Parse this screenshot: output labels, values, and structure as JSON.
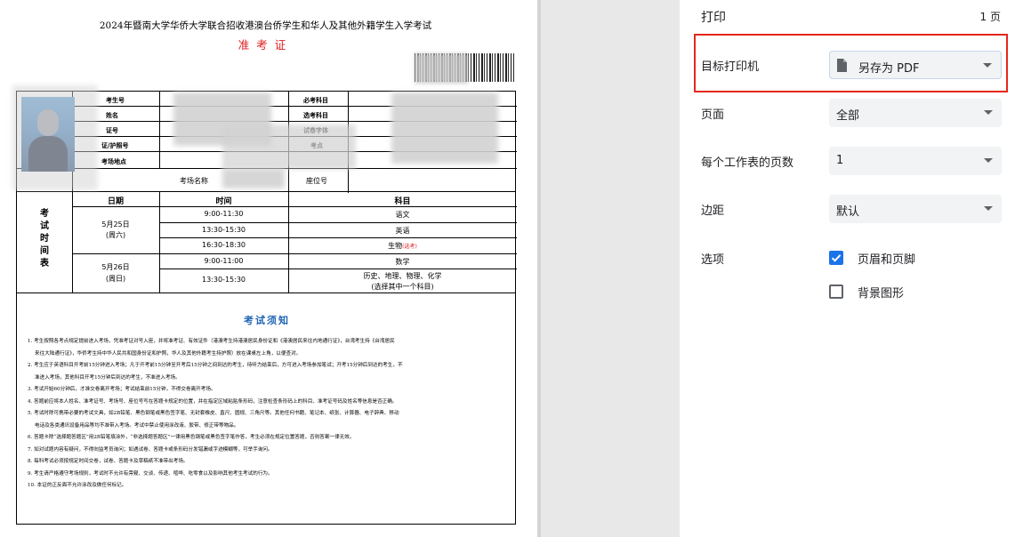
{
  "preview": {
    "exam_title": "2024年暨南大学华侨大学联合招收港澳台侨学生和华人及其他外籍学生入学考试",
    "doc_type": "准考证",
    "info_labels": {
      "candidate_no": "考生号",
      "name": "姓名",
      "gender_id": "证号",
      "passport": "证/护照号",
      "exam_site": "考场地点",
      "required": "必考科目",
      "optional": "选考科目",
      "font": "试卷字体",
      "exam_point": "考点",
      "room_name": "考场名称",
      "seat_no": "座位号"
    },
    "schedule": {
      "side_label": "考\n试\n时\n间\n表",
      "headers": {
        "date": "日期",
        "time": "时间",
        "subject": "科目"
      },
      "day1": {
        "date": "5月25日",
        "weekday": "(周六)"
      },
      "day2": {
        "date": "5月26日",
        "weekday": "(周日)"
      },
      "rows": [
        {
          "time": "9:00-11:30",
          "subject": "语文"
        },
        {
          "time": "13:30-15:30",
          "subject": "英语"
        },
        {
          "time": "16:30-18:30",
          "subject": "生物",
          "note": "(选考)"
        },
        {
          "time": "9:00-11:00",
          "subject": "数学"
        },
        {
          "time": "13:30-15:30",
          "subject": "历史、地理、物理、化学",
          "note": "(选择其中一个科目)"
        }
      ]
    },
    "notice_title": "考试须知",
    "rules": [
      "1. 考生按照各考点规定提前进入考场，凭准考证对号入座，并将准考证、有效证件（港澳考生持港澳居民身份证和《港澳居民来往内地通行证》，台湾考生持《台湾居民",
      "来往大陆通行证》，华侨考生持中华人民共和国身份证和护照，华人及其他外籍考生持护照）放在课桌左上角，以便查对。",
      "2. 考生应于英语科目开考前15分钟进入考场；凡于开考前15分钟至开考后15分钟之间到达的考生，待听力结束后，方可进入考场参加笔试；开考15分钟后到达的考生，不",
      "准进入考场，其他科目开考15分钟后到达的考生，不准进入考场。",
      "3. 考试开始60分钟后，才准交卷离开考场；考试结束前15分钟，不得交卷离开考场。",
      "4. 答题前应将本人姓名、准考证号、考场号、座位号写在答题卡规定的位置，并在指定区域粘贴条形码，注意检查条形码上的科目、准考证号码及姓名等信息是否正确。",
      "5. 考试时除可携带必要的考试文具，如2B铅笔、黑色钢笔或黑色签字笔、无封套橡皮、直尺、圆规、三角尺等。其他任何书籍、笔记本、纸张、计算器、电子辞典、移动",
      "电话及各类通讯设备用品等均不准带入考场。考试中禁止使用涂改液、胶带、修正带等物品。",
      "6. 答题卡除“选择题答题区”用2B铅笔填涂外，“非选择题答题区”一律用黑色钢笔或黑色签字笔作答，考生必须在规定位置答题，否则答案一律无效。",
      "7. 如对试题内容有疑问，不得向监考员询问；如遇试卷、答题卡或条形码分发错漏或字迹模糊等，可举手询问。",
      "8. 每科考试必须按规定时间交卷，试卷、答题卡及草稿纸不准带出考场。",
      "9. 考生请严格遵守考场规则，考试时不允许有旁窥、交谈、传递、喧哗、吃零食以及影响其他考生考试的行为。",
      "10. 本证的正反面不允许涂改及做任何标记。"
    ]
  },
  "panel": {
    "title": "打印",
    "page_count": "1 页",
    "destination": {
      "label": "目标打印机",
      "value": "另存为 PDF",
      "icon": "document-icon"
    },
    "pages": {
      "label": "页面",
      "value": "全部"
    },
    "pages_per_sheet": {
      "label": "每个工作表的页数",
      "value": "1"
    },
    "margins": {
      "label": "边距",
      "value": "默认"
    },
    "options": {
      "label": "选项",
      "headers_footers": {
        "label": "页眉和页脚",
        "checked": true
      },
      "background": {
        "label": "背景图形",
        "checked": false
      }
    },
    "colors": {
      "highlight_box": "#e5271c",
      "checkbox_on": "#1a73e8"
    }
  }
}
